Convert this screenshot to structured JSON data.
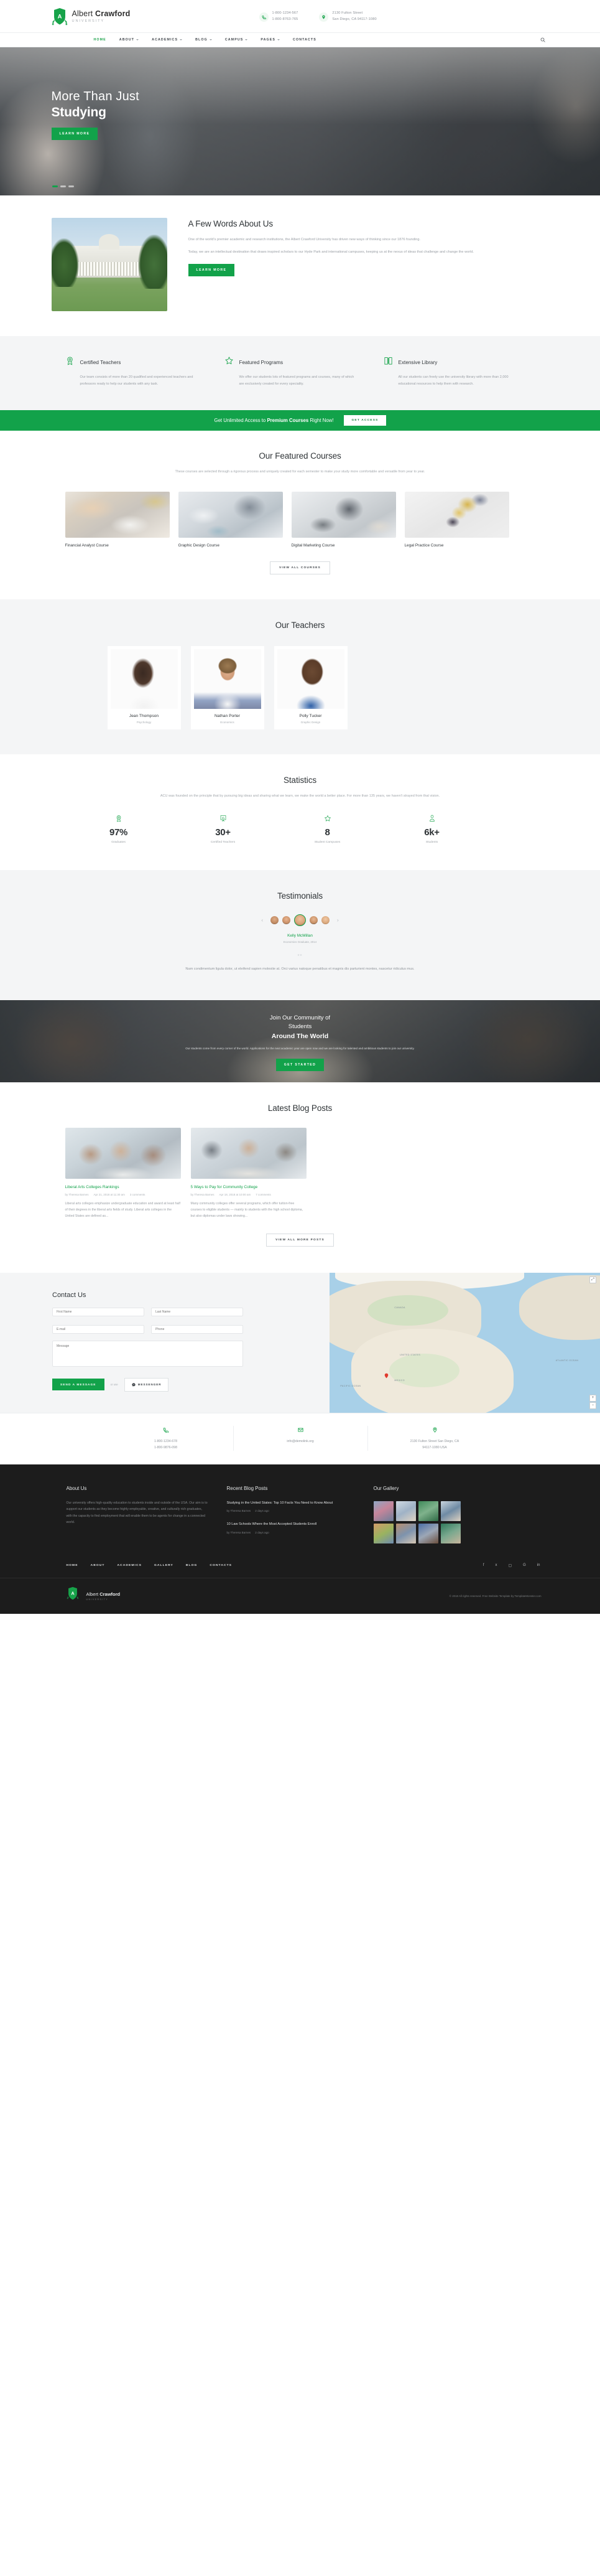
{
  "brand": {
    "name_light": "Albert ",
    "name_bold": "Crawford",
    "subtitle": "UNIVERSITY",
    "letter": "A"
  },
  "topbar": {
    "phone1": "1-800-1234-567",
    "phone2": "1-800-8763-765",
    "address1": "2130 Fulton Street",
    "address2": "San Diego, CA 94117-1080"
  },
  "nav": {
    "items": [
      {
        "label": "HOME",
        "caret": false,
        "active": true
      },
      {
        "label": "ABOUT",
        "caret": true,
        "active": false
      },
      {
        "label": "ACADEMICS",
        "caret": true,
        "active": false
      },
      {
        "label": "BLOG",
        "caret": true,
        "active": false
      },
      {
        "label": "CAMPUS",
        "caret": true,
        "active": false
      },
      {
        "label": "PAGES",
        "caret": true,
        "active": false
      },
      {
        "label": "CONTACTS",
        "caret": false,
        "active": false
      }
    ]
  },
  "hero": {
    "line1": "More Than Just",
    "line2": "Studying",
    "button": "LEARN MORE"
  },
  "about": {
    "title": "A Few Words About Us",
    "p1": "One of the world's premier academic and research institutions, the Albert Crawford University has driven new ways of thinking since our 1876 founding.",
    "p2": "Today, we are an intellectual destination that draws inspired scholars to our Hyde Park and international campuses, keeping us at the nexus of ideas that challenge and change the world.",
    "button": "LEARN MORE"
  },
  "features": [
    {
      "icon": "award-icon",
      "title": "Certified Teachers",
      "text": "Our team consists of more than 20 qualified and experienced teachers and professors ready to help our students with any task."
    },
    {
      "icon": "star-icon",
      "title": "Featured Programs",
      "text": "We offer our students lots of featured programs and courses, many of which are exclusively created for every speciality."
    },
    {
      "icon": "book-icon",
      "title": "Extensive Library",
      "text": "All our students can freely use the university library with more than 2,000 educational resources to help them with research."
    }
  ],
  "cta": {
    "text_before": "Get Unlimited Access to ",
    "text_bold": "Premium Courses",
    "text_after": " Right Now!",
    "button": "GET ACCESS"
  },
  "courses": {
    "title": "Our Featured Courses",
    "subtitle": "These courses are selected through a rigorous process and uniquely created for each semester to make your study more comfortable and versatile from year to year.",
    "items": [
      {
        "name": "Financial Analyst Course"
      },
      {
        "name": "Graphic Design Course"
      },
      {
        "name": "Digital Marketing Course"
      },
      {
        "name": "Legal Practice Course"
      }
    ],
    "button": "VIEW ALL COURSES"
  },
  "teachers": {
    "title": "Our Teachers",
    "items": [
      {
        "name": "Jean Thompson",
        "role": "Psychology"
      },
      {
        "name": "Nathan Porter",
        "role": "Economics"
      },
      {
        "name": "Polly Tucker",
        "role": "Graphic Design"
      }
    ]
  },
  "statistics": {
    "title": "Statistics",
    "subtitle": "ACU was founded on the principle that by pursuing big ideas and sharing what we learn, we make the world a better place. For more than 135 years, we haven't strayed from that vision.",
    "items": [
      {
        "icon": "award-icon",
        "value": "97%",
        "label": "Graduates"
      },
      {
        "icon": "board-icon",
        "value": "30+",
        "label": "Certified Teachers"
      },
      {
        "icon": "star-icon",
        "value": "8",
        "label": "Student Campuses"
      },
      {
        "icon": "person-icon",
        "value": "6k+",
        "label": "Students"
      }
    ]
  },
  "testimonials": {
    "title": "Testimonials",
    "name": "Kelly McMillan",
    "role": "Economics Graduate, 2014",
    "quote_mark": "””",
    "text": "Nam condimentum ligula dolor, ut eleifend sapien molestie at. Orci varius natoque penatibus et magnis dis parturient montes, nascetur ridiculus mus.",
    "prev": "‹",
    "next": "›"
  },
  "community": {
    "line1": "Join Our Community of",
    "line2": "Students",
    "line3": "Around The World",
    "text": "Our students come from every corner of the world. Applications for the next academic year are open now and we are looking for talented and ambitious students to join our university.",
    "button": "GET STARTED"
  },
  "blog": {
    "title": "Latest Blog Posts",
    "posts": [
      {
        "title": "Liberal Arts Colleges Rankings",
        "author": "by Theresa Barnes",
        "date": "Apr 21, 2018 at 11:30 am",
        "comments": "3 comments",
        "text": "Liberal arts colleges emphasize undergraduate education and award at least half of their degrees in the liberal arts fields of study. Liberal arts colleges in the United States are defined as..."
      },
      {
        "title": "5 Ways to Pay for Community College",
        "author": "by Theresa Barnes",
        "date": "Apr 18, 2018 at 10:00 am",
        "comments": "7 comments",
        "text": "Many community colleges offer several programs, which offer tuition-free courses to eligible students — mainly to students with the high school diploma, but also diplomas under laws showing..."
      }
    ],
    "button": "VIEW ALL MORE POSTS"
  },
  "contact": {
    "title": "Contact Us",
    "fields": {
      "first_name": "First Name",
      "last_name": "Last Name",
      "email": "E-mail",
      "phone": "Phone",
      "message": "Message"
    },
    "send_button": "SEND A MESSAGE",
    "or": "or use",
    "messenger_button": "MESSENGER",
    "map": {
      "labels": [
        "CANADA",
        "UNITED STATES",
        "MEXICO",
        "ATLANTIC OCEAN",
        "PACIFIC OCEAN"
      ],
      "zoom_in": "+",
      "zoom_out": "−",
      "fullscreen": "⤢"
    }
  },
  "strip": [
    {
      "icon": "phone-icon",
      "line1": "1-800-1234-678",
      "line2": "1-800-9876-098"
    },
    {
      "icon": "mail-icon",
      "line1": "info@demolink.org",
      "line2": ""
    },
    {
      "icon": "pin-icon",
      "line1": "2130 Fulton Street San Diego, CA",
      "line2": "94117-1080 USA"
    }
  ],
  "footer": {
    "about_title": "About Us",
    "about_text": "Our university offers high-quality education to students inside and outside of the USA. Our aim is to support our students as they become highly employable, creative, and culturally rich graduates, with the capacity to find employment that will enable them to be agents for change in a connected world.",
    "blog_title": "Recent Blog Posts",
    "posts": [
      {
        "title": "Studying in the United States: Top 10 Facts You Need to Know About",
        "author": "by Theresa Barnes",
        "date": "2 days ago"
      },
      {
        "title": "10 Law Schools Where the Most Accepted Students Enroll",
        "author": "by Theresa Barnes",
        "date": "2 days ago"
      }
    ],
    "gallery_title": "Our Gallery",
    "nav": [
      "HOME",
      "ABOUT",
      "ACADEMICS",
      "GALLERY",
      "BLOG",
      "CONTACTS"
    ],
    "social": [
      "facebook-icon",
      "twitter-icon",
      "instagram-icon",
      "google-plus-icon",
      "linkedin-icon"
    ],
    "copyright": "© 2018 All rights reserved. Free Website Template by TemplateMonster.com"
  },
  "colors": {
    "accent": "#12a24a",
    "dark": "#1c1c1c",
    "muted": "#9a9fa5"
  }
}
